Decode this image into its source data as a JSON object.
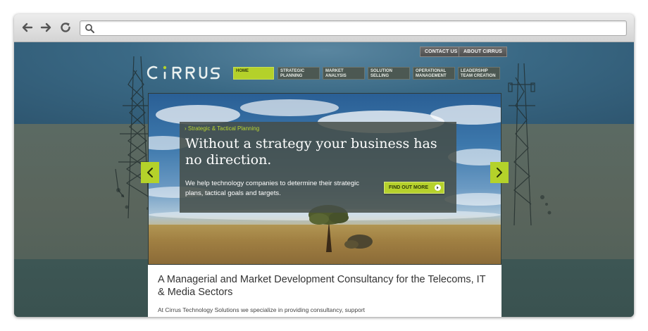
{
  "browser": {
    "url": "",
    "back_icon": "arrow-left-icon",
    "forward_icon": "arrow-right-icon",
    "reload_icon": "reload-icon",
    "search_icon": "search-icon"
  },
  "site": {
    "utility_nav": [
      "CONTACT US",
      "ABOUT CIRRUS"
    ],
    "logo_text": "CIRRUS",
    "menu": [
      {
        "label": "HOME",
        "active": true
      },
      {
        "label": "STRATEGIC PLANNING"
      },
      {
        "label": "MARKET ANALYSIS"
      },
      {
        "label": "SOLUTION SELLING"
      },
      {
        "label": "OPERATIONAL MANAGEMENT"
      },
      {
        "label": "LEADERSHIP TEAM CREATION"
      }
    ],
    "hero": {
      "tag": "Strategic & Tactical Planning",
      "headline": "Without a strategy your business has no direction.",
      "body": "We help technology companies to determine their strategic plans, tactical goals and targets.",
      "cta": "FIND OUT MORE"
    },
    "content": {
      "heading": "A Managerial and Market Development Consultancy for the Telecoms, IT & Media Sectors",
      "paragraph": "At Cirrus Technology Solutions we specialize in providing consultancy, support"
    },
    "colors": {
      "accent": "#b4d22a",
      "header_band": "#3a6985",
      "mid_band": "#5a655c",
      "bottom_band": "#3d5654"
    }
  }
}
